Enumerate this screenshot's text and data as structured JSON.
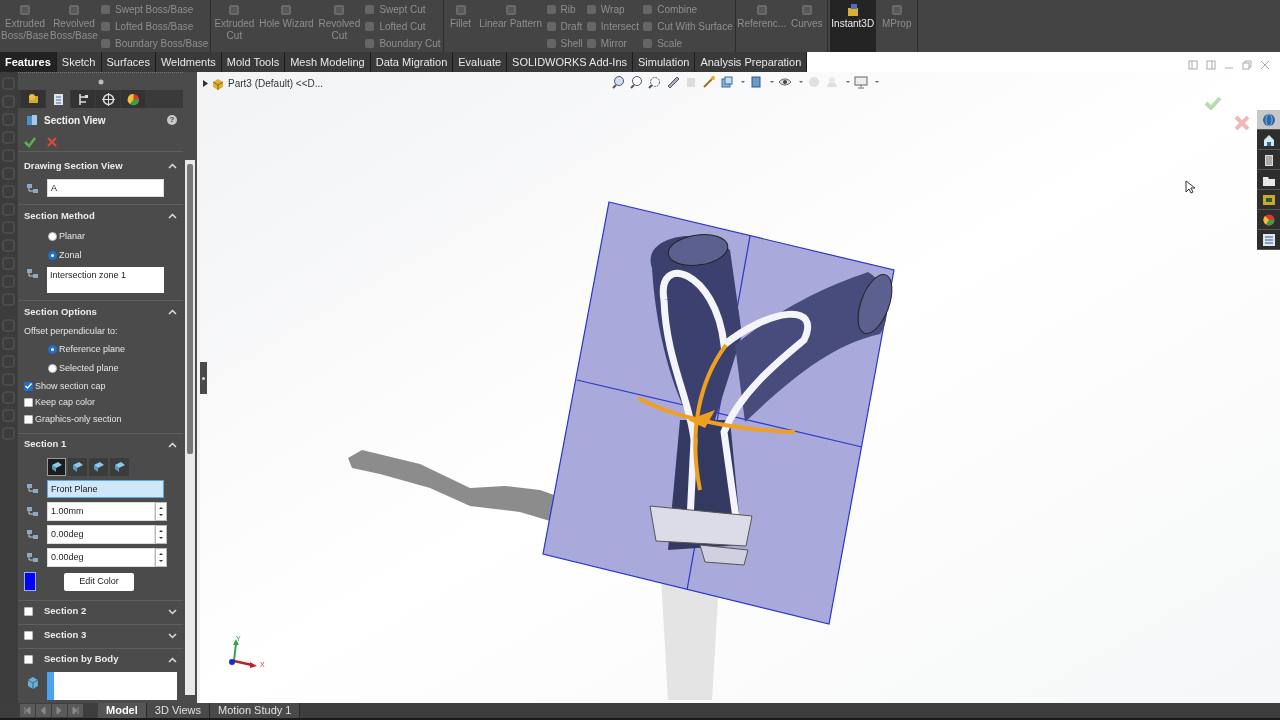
{
  "ribbon_groups": [
    {
      "items": [
        {
          "kind": "large",
          "label": "Extruded Boss/Base",
          "selected": false
        },
        {
          "kind": "large",
          "label": "Revolved Boss/Base",
          "selected": false
        },
        {
          "kind": "stack",
          "labels": [
            "Swept Boss/Base",
            "Lofted Boss/Base",
            "Boundary Boss/Base"
          ]
        }
      ]
    },
    {
      "items": [
        {
          "kind": "large",
          "label": "Extruded Cut",
          "selected": false
        },
        {
          "kind": "large",
          "label": "Hole Wizard",
          "selected": false
        },
        {
          "kind": "large",
          "label": "Revolved Cut",
          "selected": false
        },
        {
          "kind": "stack",
          "labels": [
            "Swept Cut",
            "Lofted Cut",
            "Boundary Cut"
          ]
        }
      ]
    },
    {
      "items": [
        {
          "kind": "large",
          "label": "Fillet",
          "selected": false
        },
        {
          "kind": "large",
          "label": "Linear Pattern",
          "selected": false
        },
        {
          "kind": "stack",
          "labels": [
            "Rib",
            "Draft",
            "Shell"
          ]
        },
        {
          "kind": "stack",
          "labels": [
            "Wrap",
            "Intersect",
            "Mirror"
          ]
        },
        {
          "kind": "stack",
          "labels": [
            "Combine",
            "Cut With Surface",
            "Scale"
          ]
        }
      ]
    },
    {
      "items": [
        {
          "kind": "large",
          "label": "Referenc...",
          "selected": false
        },
        {
          "kind": "large",
          "label": "Curves",
          "selected": false
        }
      ]
    },
    {
      "items": [
        {
          "kind": "large",
          "label": "Instant3D",
          "selected": true
        },
        {
          "kind": "large",
          "label": "MProp",
          "selected": false
        }
      ]
    }
  ],
  "command_tabs": [
    {
      "label": "Features",
      "selected": true
    },
    {
      "label": "Sketch",
      "selected": false
    },
    {
      "label": "Surfaces",
      "selected": false
    },
    {
      "label": "Weldments",
      "selected": false
    },
    {
      "label": "Mold Tools",
      "selected": false
    },
    {
      "label": "Mesh Modeling",
      "selected": false
    },
    {
      "label": "Data Migration",
      "selected": false
    },
    {
      "label": "Evaluate",
      "selected": false
    },
    {
      "label": "SOLIDWORKS Add-Ins",
      "selected": false
    },
    {
      "label": "Simulation",
      "selected": false
    },
    {
      "label": "Analysis Preparation",
      "selected": false
    }
  ],
  "document_tree": {
    "label": "Part3 (Default) <<D..."
  },
  "property_manager": {
    "tabs": [
      {
        "selected": false
      },
      {
        "selected": true
      },
      {
        "selected": false
      },
      {
        "selected": false
      },
      {
        "selected": false
      }
    ],
    "title": "Section View",
    "help_glyph": "?",
    "sections": [
      {
        "title": "Drawing Section View",
        "kind": "plain",
        "expanded": true,
        "rows": [
          {
            "kind": "field",
            "value": "A",
            "highlighted": false
          }
        ]
      },
      {
        "title": "Section Method",
        "kind": "plain",
        "expanded": true,
        "rows": [
          {
            "kind": "radio",
            "label": "Planar",
            "selected": false
          },
          {
            "kind": "radio",
            "label": "Zonal",
            "selected": true
          },
          {
            "kind": "tall_field",
            "value": "Intersection zone 1"
          }
        ]
      },
      {
        "title": "Section Options",
        "kind": "plain",
        "expanded": true,
        "rows": [
          {
            "kind": "label",
            "text": "Offset perpendicular to:"
          },
          {
            "kind": "radio",
            "label": "Reference plane",
            "selected": true
          },
          {
            "kind": "radio",
            "label": "Selected plane",
            "selected": false
          },
          {
            "kind": "checkbox",
            "label": "Show section cap",
            "checked": true
          },
          {
            "kind": "checkbox",
            "label": "Keep cap color",
            "checked": false
          },
          {
            "kind": "checkbox",
            "label": "Graphics-only section",
            "checked": false
          }
        ]
      },
      {
        "title": "Section 1",
        "kind": "plain",
        "expanded": true,
        "rows": [
          {
            "kind": "icon_buttons",
            "buttons": [
              {
                "selected": true
              },
              {
                "selected": false
              },
              {
                "selected": false
              },
              {
                "selected": false
              }
            ]
          },
          {
            "kind": "field",
            "value": "Front Plane",
            "highlighted": true
          },
          {
            "kind": "spin",
            "value": "1.00mm"
          },
          {
            "kind": "spin",
            "value": "0.00deg"
          },
          {
            "kind": "spin",
            "value": "0.00deg"
          },
          {
            "kind": "color",
            "color": "#0000ff",
            "button": "Edit Color"
          }
        ]
      },
      {
        "title": "Section 2",
        "kind": "checkable",
        "checked": false,
        "expanded": false
      },
      {
        "title": "Section 3",
        "kind": "checkable",
        "checked": false,
        "expanded": false
      },
      {
        "title": "Section by Body",
        "kind": "checkable",
        "checked": false,
        "expanded": true,
        "rows": [
          {
            "kind": "list_box"
          }
        ]
      }
    ]
  },
  "view_triad": {
    "x_label": "X",
    "y_label": "Y"
  },
  "task_pane": [
    {
      "selected": true
    },
    {
      "selected": false
    },
    {
      "selected": false
    },
    {
      "selected": false
    },
    {
      "selected": false
    },
    {
      "selected": false
    },
    {
      "selected": false
    }
  ],
  "bottom_tabs": [
    {
      "label": "Model",
      "selected": true
    },
    {
      "label": "3D Views",
      "selected": false
    },
    {
      "label": "Motion Study 1",
      "selected": false
    }
  ]
}
